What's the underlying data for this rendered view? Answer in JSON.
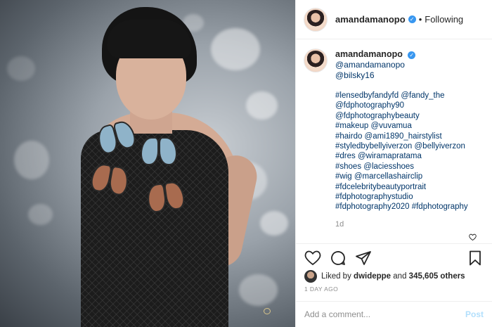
{
  "post": {
    "username": "amandamanopo",
    "follow_status": "Following",
    "separator": "•",
    "verified_mark": "✓"
  },
  "caption": {
    "username": "amandamanopo",
    "mention_1": "@amandamanopo",
    "mention_2": "@bilsky16",
    "lines": [
      "#lensedbyfandyfd @fandy_the",
      "@fdphotography90",
      "@fdphotographybeauty",
      "#makeup @vuvamua",
      "#hairdo @ami1890_hairstylist",
      "#styledbybellyiverzon @bellyiverzon",
      "#dres @wiramapratama",
      "#shoes @laciesshoes",
      "#wig @marcellashairclip",
      "#fdcelebritybeautyportrait",
      "#fdphotographystudio",
      "#fdphotography2020 #fdphotography"
    ],
    "age": "1d"
  },
  "engagement": {
    "liked_by_prefix": "Liked by",
    "liked_by_user": "dwideppe",
    "and_text": "and",
    "others": "345,605 others",
    "timestamp": "1 DAY AGO"
  },
  "comment_box": {
    "placeholder": "Add a comment...",
    "post_label": "Post"
  },
  "icons": {
    "like": "heart-icon",
    "comment": "comment-icon",
    "share": "share-icon",
    "save": "bookmark-icon"
  },
  "colors": {
    "link": "#003569",
    "verified": "#3897f0",
    "muted": "#8e8e8e",
    "post_disabled": "#b2dffc"
  }
}
